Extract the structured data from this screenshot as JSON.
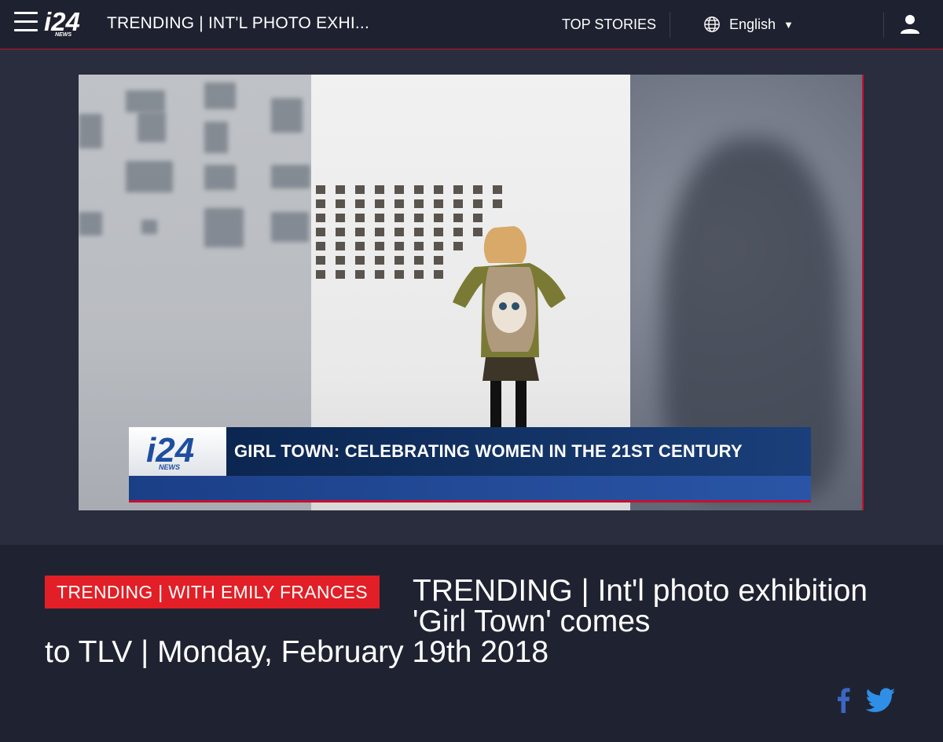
{
  "header": {
    "menu_icon": "hamburger-icon",
    "logo_text": "i24",
    "logo_sub": "NEWS",
    "breadcrumb": "TRENDING | INT'L PHOTO EXHI...",
    "top_stories_label": "TOP STORIES",
    "language_label": "English",
    "language_icon": "globe-icon",
    "user_icon": "user-icon"
  },
  "video": {
    "lower_third_logo": "i24",
    "lower_third_logo_sub": "NEWS",
    "lower_third_title": "GIRL TOWN: CELEBRATING WOMEN IN THE 21ST CENTURY"
  },
  "article": {
    "badge": "TRENDING | WITH EMILY FRANCES",
    "headline_line1": "TRENDING | Int'l photo exhibition 'Girl Town' comes",
    "headline_line2": "to TLV | Monday, February 19th 2018"
  },
  "share": {
    "facebook_icon": "facebook-icon",
    "twitter_icon": "twitter-icon"
  },
  "colors": {
    "accent": "#e21f26",
    "background": "#1f2331",
    "lower_third_blue": "#0b2650"
  }
}
